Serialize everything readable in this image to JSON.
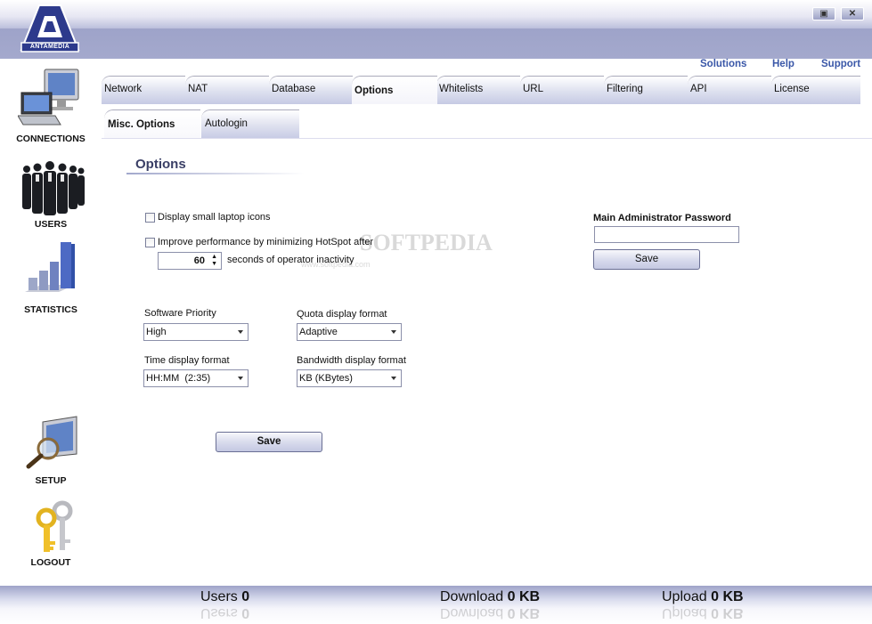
{
  "brand": {
    "logo_text": "ANTAMEDIA"
  },
  "window": {
    "restore_icon": "restore-icon",
    "close_icon": "close-icon"
  },
  "toplinks": {
    "solutions": "Solutions",
    "help": "Help",
    "support": "Support"
  },
  "sidebar": {
    "items": [
      {
        "label": "CONNECTIONS",
        "icon": "computer-icon"
      },
      {
        "label": "USERS",
        "icon": "users-icon"
      },
      {
        "label": "STATISTICS",
        "icon": "statistics-icon"
      },
      {
        "label": "SETUP",
        "icon": "setup-icon"
      },
      {
        "label": "LOGOUT",
        "icon": "keys-icon"
      }
    ]
  },
  "tabs": [
    {
      "label": "Network"
    },
    {
      "label": "NAT"
    },
    {
      "label": "Database"
    },
    {
      "label": "Options"
    },
    {
      "label": "Whitelists"
    },
    {
      "label": "URL"
    },
    {
      "label": "Filtering"
    },
    {
      "label": "API"
    },
    {
      "label": "License"
    }
  ],
  "subtabs": [
    {
      "label": "Misc. Options"
    },
    {
      "label": "Autologin"
    }
  ],
  "options": {
    "title": "Options",
    "small_icons_label": "Display small laptop icons",
    "improve_label": "Improve performance by minimizing HotSpot after",
    "inactivity_value": "60",
    "inactivity_suffix": "seconds of operator inactivity",
    "software_priority_label": "Software Priority",
    "software_priority_value": "High",
    "quota_format_label": "Quota display format",
    "quota_format_value": "Adaptive",
    "time_format_label": "Time display format",
    "time_format_value": "HH:MM  (2:35)",
    "bandwidth_format_label": "Bandwidth display format",
    "bandwidth_format_value": "KB (KBytes)",
    "save_label": "Save"
  },
  "admin": {
    "password_label": "Main Administrator Password",
    "password_value": "",
    "save_label": "Save"
  },
  "footer": {
    "users_label": "Users",
    "users_value": "0",
    "download_label": "Download",
    "download_value": "0 KB",
    "upload_label": "Upload",
    "upload_value": "0 KB"
  },
  "watermark": {
    "main": "SOFTPEDIA",
    "sub": "www.softpedia.com"
  },
  "colors": {
    "accent": "#9ea3c9",
    "link": "#3a57a8",
    "title": "#3a3f66"
  }
}
